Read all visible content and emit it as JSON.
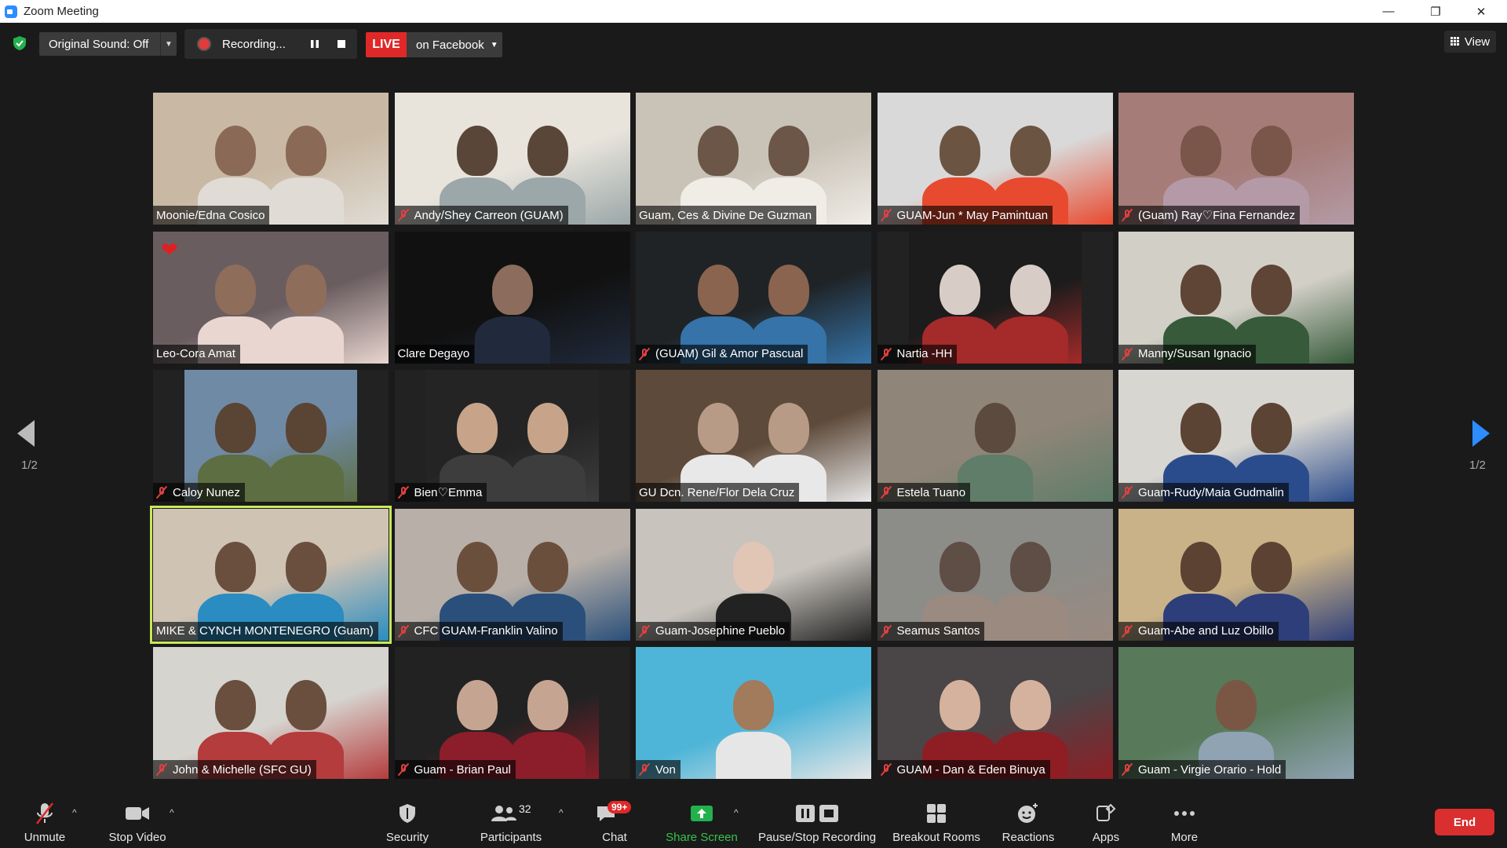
{
  "window": {
    "title": "Zoom Meeting"
  },
  "topbar": {
    "original_sound": "Original Sound: Off",
    "recording": "Recording...",
    "live": "LIVE",
    "live_destination": "on Facebook",
    "view": "View"
  },
  "pagination": {
    "left": "1/2",
    "right": "1/2"
  },
  "participants": [
    {
      "name": "Moonie/Edna Cosico",
      "muted": false
    },
    {
      "name": "Andy/Shey Carreon (GUAM)",
      "muted": true
    },
    {
      "name": "Guam, Ces & Divine De Guzman",
      "muted": false
    },
    {
      "name": "GUAM-Jun * May  Pamintuan",
      "muted": true
    },
    {
      "name": "(Guam) Ray♡Fina Fernandez",
      "muted": true
    },
    {
      "name": "Leo-Cora Amat",
      "muted": false
    },
    {
      "name": "Clare Degayo",
      "muted": false
    },
    {
      "name": "(GUAM) Gil & Amor Pascual",
      "muted": true
    },
    {
      "name": "Nartia -HH",
      "muted": true
    },
    {
      "name": "Manny/Susan Ignacio",
      "muted": true
    },
    {
      "name": "Caloy Nunez",
      "muted": true
    },
    {
      "name": "Bien♡Emma",
      "muted": true
    },
    {
      "name": "GU Dcn. Rene/Flor Dela Cruz",
      "muted": false
    },
    {
      "name": "Estela Tuano",
      "muted": true
    },
    {
      "name": "Guam-Rudy/Maia Gudmalin",
      "muted": true
    },
    {
      "name": "MIKE & CYNCH MONTENEGRO (Guam)",
      "muted": false
    },
    {
      "name": "CFC GUAM-Franklin Valino",
      "muted": true
    },
    {
      "name": "Guam-Josephine Pueblo",
      "muted": true
    },
    {
      "name": "Seamus Santos",
      "muted": true
    },
    {
      "name": "Guam-Abe and Luz Obillo",
      "muted": true
    },
    {
      "name": "John & Michelle (SFC GU)",
      "muted": true
    },
    {
      "name": "Guam - Brian Paul",
      "muted": true
    },
    {
      "name": "Von",
      "muted": true
    },
    {
      "name": "GUAM - Dan & Eden Binuya",
      "muted": true
    },
    {
      "name": "Guam - Virgie Orario - Hold",
      "muted": true
    }
  ],
  "toolbar": {
    "unmute": "Unmute",
    "stop_video": "Stop Video",
    "security": "Security",
    "participants": "Participants",
    "participants_count": "32",
    "chat": "Chat",
    "chat_badge": "99+",
    "share_screen": "Share Screen",
    "pause_stop_recording": "Pause/Stop Recording",
    "breakout_rooms": "Breakout Rooms",
    "reactions": "Reactions",
    "apps": "Apps",
    "more": "More",
    "end": "End"
  },
  "colors": {
    "accent": "#2d8cff",
    "live": "#e02828",
    "share": "#37c24d",
    "active_speaker": "#c8e85a"
  }
}
